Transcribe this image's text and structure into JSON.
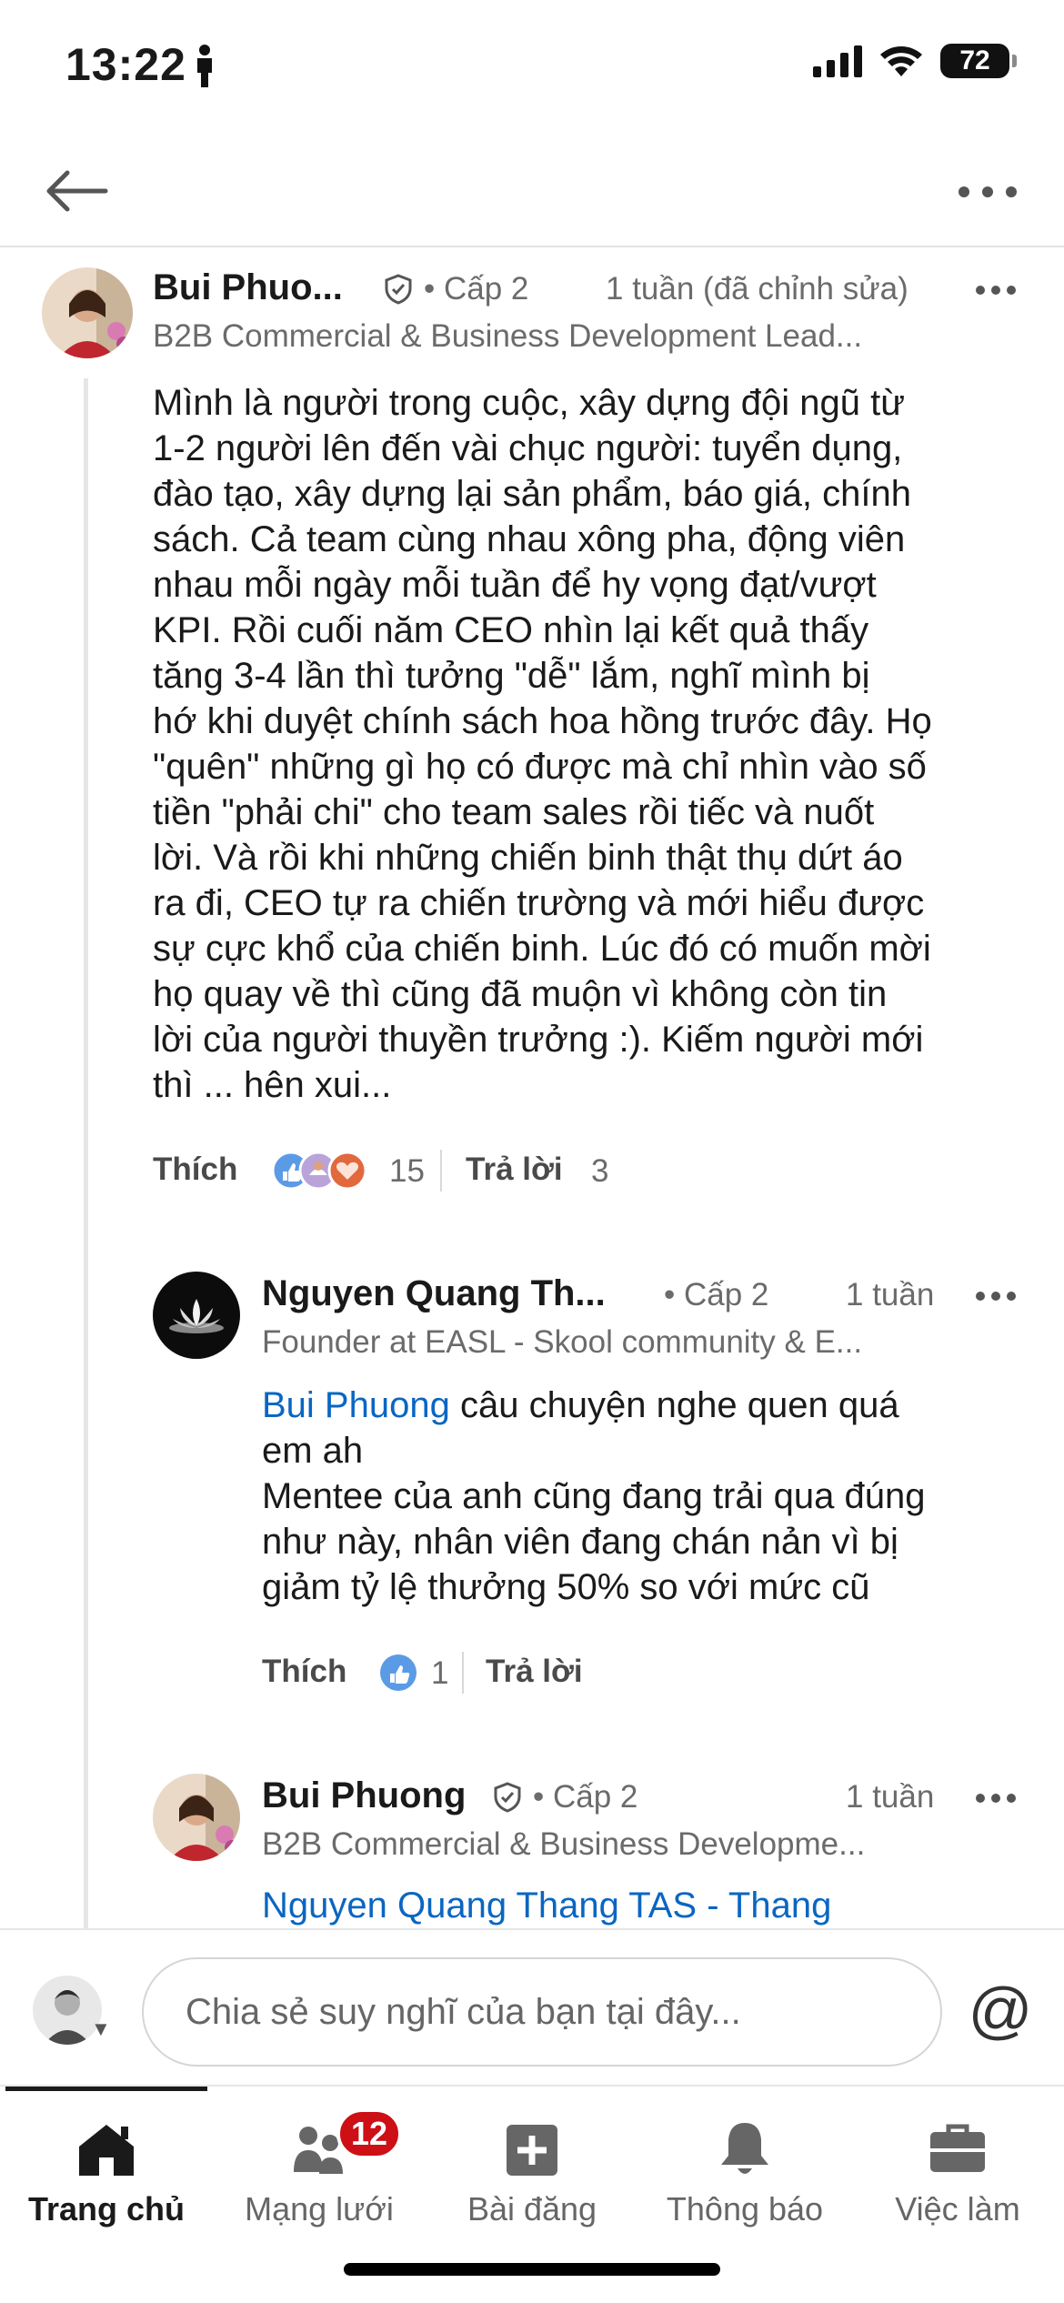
{
  "status_bar": {
    "time": "13:22",
    "battery": "72"
  },
  "comments": [
    {
      "author": "Bui Phuo...",
      "degree": "• Cấp 2",
      "time": "1 tuần (đã chỉnh sửa)",
      "headline": "B2B Commercial & Business Development Lead...",
      "text": "Mình là người trong cuộc, xây dựng đội ngũ từ\n1-2 người lên đến vài chục người: tuyển dụng,\nđào tạo, xây dựng lại sản phẩm, báo giá, chính\nsách. Cả team cùng nhau xông pha, động viên\nnhau mỗi ngày mỗi tuần để hy vọng đạt/vượt\nKPI. Rồi cuối năm CEO nhìn lại kết quả thấy\ntăng 3-4 lần thì tưởng \"dễ\" lắm, nghĩ mình bị\nhớ khi duyệt chính sách hoa hồng trước đây. Họ\n\"quên\" những gì họ có được mà chỉ nhìn vào số\ntiền \"phải chi\" cho team sales rồi tiếc và nuốt\nlời. Và rồi khi những chiến binh thật thụ dứt áo\nra đi, CEO tự ra chiến trường và mới hiểu được\nsự cực khổ của chiến binh. Lúc đó có muốn mời\nhọ quay về thì cũng đã muộn vì không còn tin\nlời của người thuyền trưởng :). Kiếm người mới\nthì ... hên xui...",
      "like_label": "Thích",
      "reaction_count": "15",
      "reply_label": "Trả lời",
      "reply_count": "3"
    },
    {
      "author": "Nguyen Quang Th...",
      "degree": "• Cấp 2",
      "time": "1 tuần",
      "headline": "Founder at EASL - Skool community & E...",
      "mention": "Bui Phuong",
      "text_after_mention": " câu chuyện nghe quen quá\nem ah\nMentee của anh cũng đang trải qua đúng\nnhư này, nhân viên đang chán nản vì bị\ngiảm tỷ lệ thưởng 50% so với mức cũ",
      "like_label": "Thích",
      "reaction_count": "1",
      "reply_label": "Trả lời"
    },
    {
      "author": "Bui Phuong",
      "degree": "• Cấp 2",
      "time": "1 tuần",
      "headline": "B2B Commercial & Business Developme...",
      "mention": "Nguyen Quang Thang TAS - Thang"
    }
  ],
  "composer": {
    "placeholder": "Chia sẻ suy nghĩ của bạn tại đây...",
    "at_symbol": "@"
  },
  "tabbar": {
    "tabs": [
      {
        "label": "Trang chủ",
        "icon": "home-icon"
      },
      {
        "label": "Mạng lưới",
        "icon": "network-icon",
        "badge": "12"
      },
      {
        "label": "Bài đăng",
        "icon": "post-icon"
      },
      {
        "label": "Thông báo",
        "icon": "bell-icon"
      },
      {
        "label": "Việc làm",
        "icon": "briefcase-icon"
      }
    ]
  },
  "colors": {
    "link": "#0a66c2",
    "badge": "#cc1016",
    "text": "#1a1a1a",
    "secondary": "#6b6b6b"
  }
}
